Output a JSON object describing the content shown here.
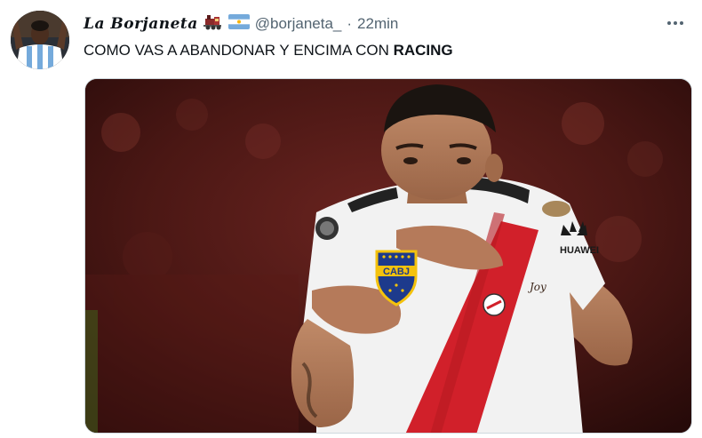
{
  "tweet": {
    "display_name": "La Borjaneta",
    "handle": "@borjaneta_",
    "separator": "·",
    "timestamp": "22min",
    "text_plain": "COMO VAS A ABANDONAR Y ENCIMA CON ",
    "text_bold": "RACING",
    "emojis": [
      "train-emoji",
      "argentina-flag-emoji"
    ],
    "more_icon": "more-options-icon",
    "media": {
      "badge_text": "CABJ",
      "tattoo_text": "Joy",
      "sponsor_text": "HUAWEI",
      "colors": {
        "jersey": "#f2f2f2",
        "sash": "#d1202a",
        "badge_blue": "#1d3a8c",
        "badge_gold": "#f4c20d",
        "background": "#4a1714"
      }
    }
  }
}
